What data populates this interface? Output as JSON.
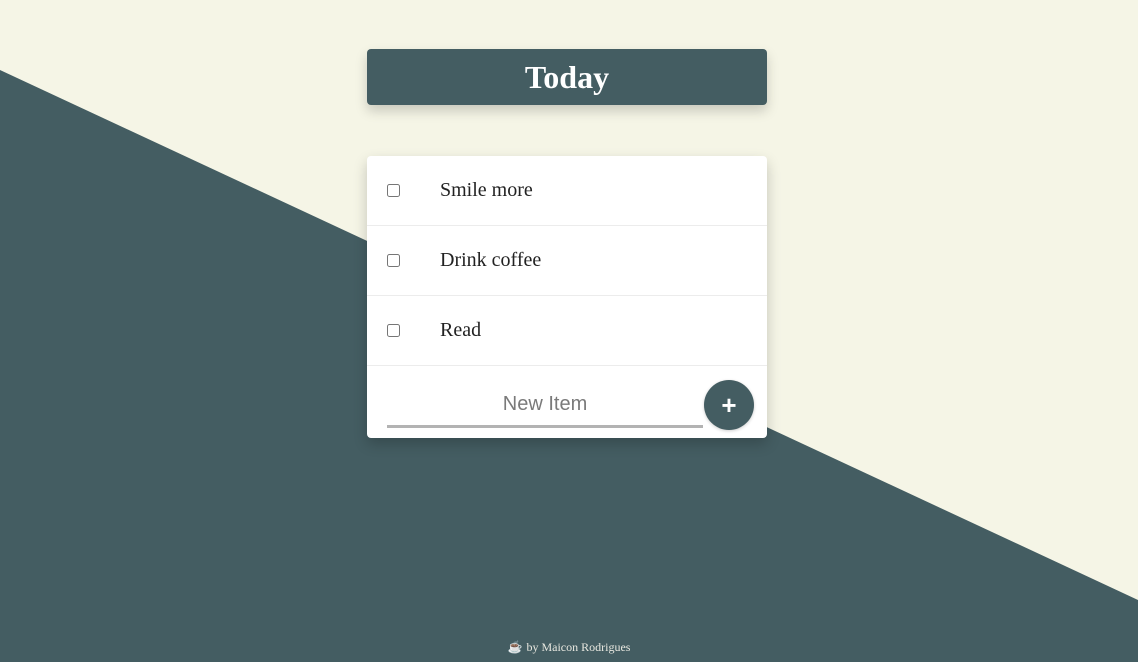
{
  "colors": {
    "background_light": "#F5F5E6",
    "background_dark": "#445D62",
    "accent": "#445D62"
  },
  "heading": {
    "title": "Today"
  },
  "items": [
    {
      "label": "Smile more",
      "checked": false
    },
    {
      "label": "Drink coffee",
      "checked": false
    },
    {
      "label": "Read",
      "checked": false
    }
  ],
  "new_item": {
    "placeholder": "New Item",
    "value": "",
    "add_label": "+"
  },
  "footer": {
    "icon": "coffee-cup-icon",
    "icon_glyph": "☕",
    "text": "by Maicon Rodrigues"
  }
}
